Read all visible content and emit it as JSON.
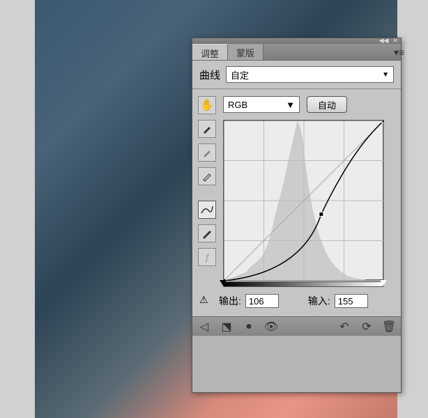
{
  "tabs": {
    "adjust": "调整",
    "mask": "蒙版"
  },
  "curve_label": "曲线",
  "preset": "自定",
  "channel": "RGB",
  "auto": "自动",
  "output_label": "输出:",
  "output_value": "106",
  "input_label": "输入:",
  "input_value": "155",
  "chart_data": {
    "type": "line",
    "title": "Curves",
    "xlabel": "Input",
    "ylabel": "Output",
    "xlim": [
      0,
      255
    ],
    "ylim": [
      0,
      255
    ],
    "control_points": [
      {
        "x": 0,
        "y": 0
      },
      {
        "x": 155,
        "y": 106
      },
      {
        "x": 255,
        "y": 255
      }
    ],
    "histogram": [
      2,
      3,
      3,
      4,
      5,
      6,
      8,
      9,
      10,
      12,
      16,
      20,
      22,
      25,
      28,
      32,
      38,
      45,
      55,
      68,
      82,
      95,
      108,
      120,
      135,
      150,
      165,
      180,
      195,
      208,
      200,
      185,
      155,
      130,
      110,
      92,
      78,
      65,
      55,
      46,
      38,
      32,
      26,
      22,
      18,
      15,
      12,
      10,
      8,
      6,
      5,
      4,
      3,
      3,
      2,
      2,
      1,
      1,
      1,
      1,
      1,
      1,
      0,
      0
    ]
  }
}
